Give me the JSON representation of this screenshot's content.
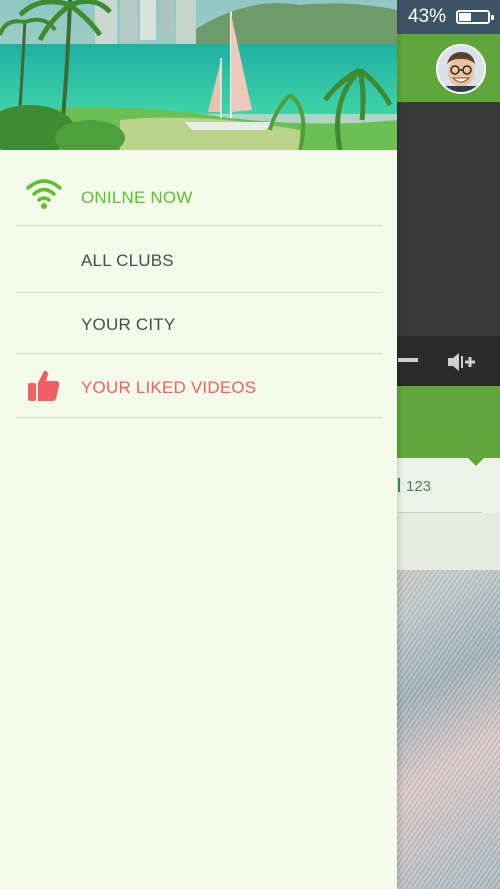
{
  "status_bar": {
    "battery_percent_text": "43%",
    "battery_level": 0.43
  },
  "drawer": {
    "menu": [
      {
        "label": "ONILNE NOW",
        "icon": "wifi-icon",
        "color": "#5cc130"
      },
      {
        "label": "ALL CLUBS",
        "icon": "",
        "color": "#4a4a4a"
      },
      {
        "label": "YOUR CITY",
        "icon": "",
        "color": "#4a4a4a"
      },
      {
        "label": "YOUR LIKED VIDEOS",
        "icon": "thumbs-up-icon",
        "color": "#ef5f63"
      }
    ]
  },
  "background_app": {
    "count": "123"
  },
  "colors": {
    "header_green": "#5fa63b",
    "drawer_bg": "#f4fbea",
    "divider": "#cfe3bf"
  }
}
